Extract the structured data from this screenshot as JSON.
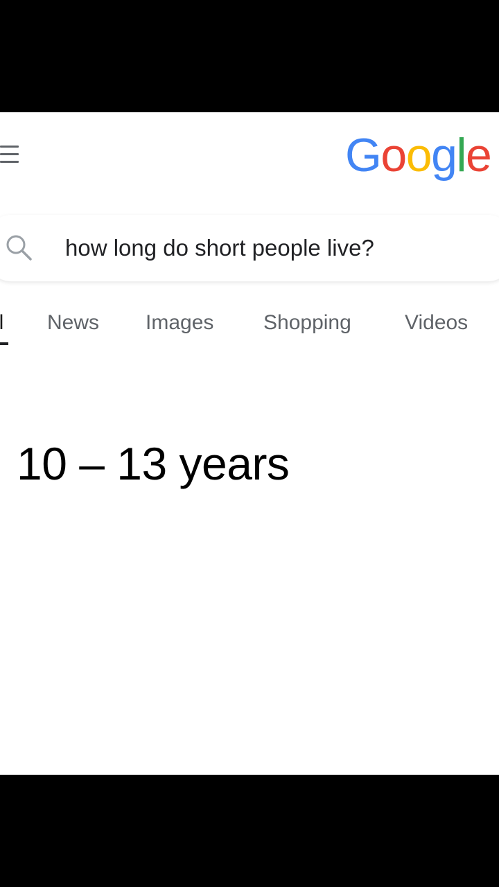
{
  "header": {
    "logo_letters": [
      {
        "char": "G",
        "color": "#4285F4"
      },
      {
        "char": "o",
        "color": "#EA4335"
      },
      {
        "char": "o",
        "color": "#FBBC05"
      },
      {
        "char": "g",
        "color": "#4285F4"
      },
      {
        "char": "l",
        "color": "#34A853"
      },
      {
        "char": "e",
        "color": "#EA4335"
      }
    ],
    "menu_icon": "hamburger-menu-icon"
  },
  "search": {
    "icon": "search-icon",
    "query": "how long do short people live?"
  },
  "tabs": [
    {
      "label": "All",
      "visible_label": "ll",
      "active": true
    },
    {
      "label": "News"
    },
    {
      "label": "Images"
    },
    {
      "label": "Shopping"
    },
    {
      "label": "Videos"
    }
  ],
  "result": {
    "answer": "10 – 13 years"
  }
}
